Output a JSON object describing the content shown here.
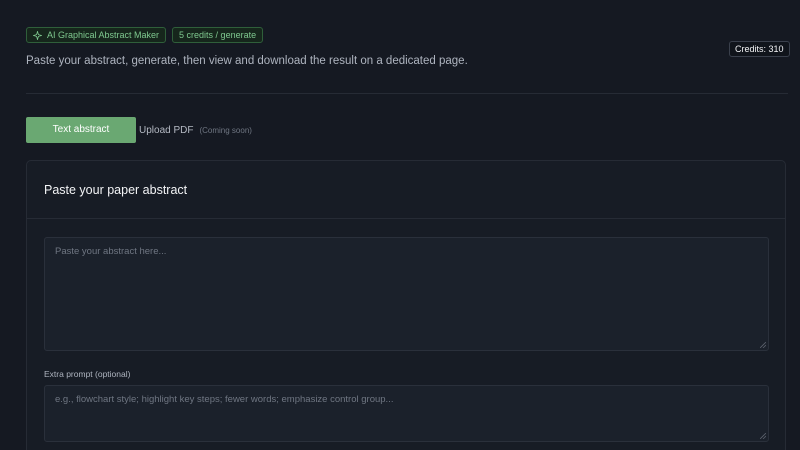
{
  "header": {
    "app_badge": "AI Graphical Abstract Maker",
    "cost_badge": "5 credits / generate",
    "credits": "Credits: 310",
    "subtitle": "Paste your abstract, generate, then view and download the result on a dedicated page."
  },
  "tabs": {
    "text_abstract": "Text abstract",
    "upload_pdf": "Upload PDF",
    "coming_soon": "(Coming soon)"
  },
  "card": {
    "title": "Paste your paper abstract",
    "abstract_placeholder": "Paste your abstract here...",
    "extra_prompt_label": "Extra prompt (optional)",
    "extra_prompt_placeholder": "e.g., flowchart style; highlight key steps; fewer words; emphasize control group..."
  },
  "icons": {
    "app_badge_icon": "sparkle-icon"
  },
  "colors": {
    "accent_green": "#6aa872",
    "badge_text": "#7fc98f",
    "background": "#151922"
  }
}
